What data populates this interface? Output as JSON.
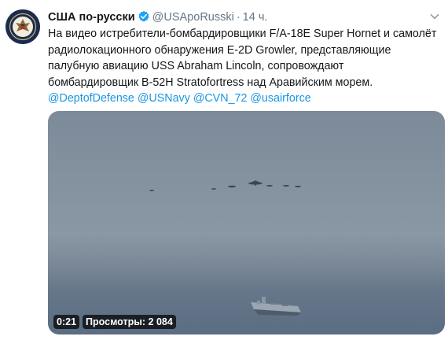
{
  "tweet": {
    "author_name": "США по-русски",
    "verified_icon": "verified-badge-icon",
    "handle": "@USApoRusski",
    "separator": "·",
    "time": "14 ч.",
    "body": "На видео истребители-бомбардировщики F/A-18E Super Hornet и самолёт радиолокационного обнаружения E-2D Growler, представляющие палубную авиацию USS Abraham Lincoln, сопровождают бомбардировщик B-52H Stratofortress над Аравийским морем.",
    "mentions": [
      "@DeptofDefense",
      "@USNavy",
      "@CVN_72",
      "@usairforce"
    ],
    "link_color": "#1b95e0"
  },
  "video": {
    "duration": "0:21",
    "views": "Просмотры: 2 084"
  }
}
